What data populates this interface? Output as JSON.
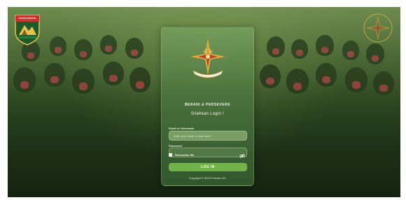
{
  "left_badge": {
    "text": "STRIVE BERCITA"
  },
  "header": {
    "title": "BERANI & PERSEVERE",
    "subtitle": "Silahkan Login !"
  },
  "form": {
    "email_label": "Email or Username",
    "email_placeholder": "Enter your email or username",
    "password_label": "Password",
    "password_value": "",
    "remember_label": "Remember Me",
    "login_label": "LOG IN"
  },
  "footer": {
    "copyright": "Copyright © 2023 Fransiro M.I"
  },
  "icons": {
    "left_crest": "unit-crest-icon",
    "right_crest": "compass-star-icon",
    "emblem": "compass-star-emblem-icon",
    "password_toggle": "eye-slash-icon"
  },
  "colors": {
    "accent": "#6fb34a",
    "card": "#5a8a4a",
    "background": "#2f4a22"
  }
}
